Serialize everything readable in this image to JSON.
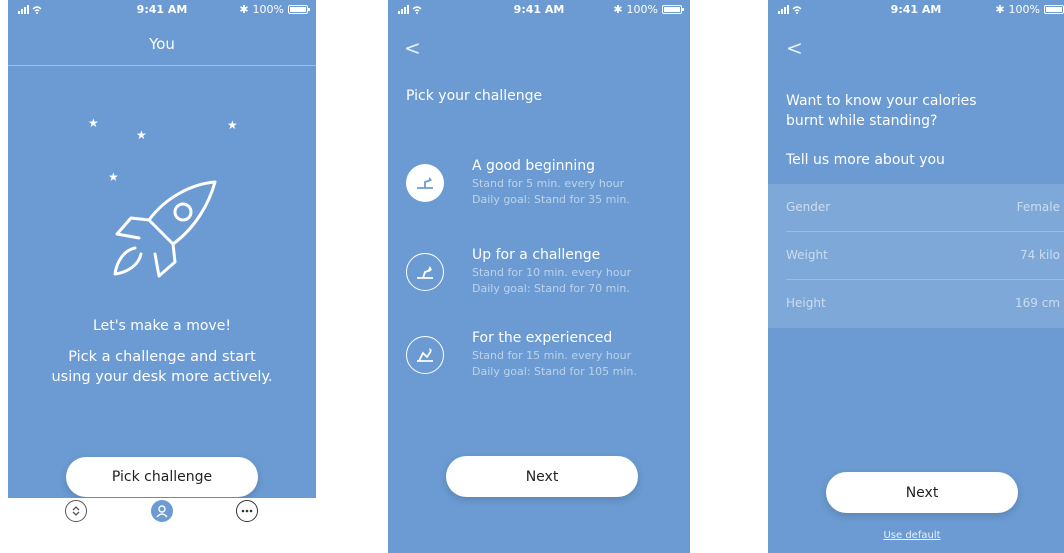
{
  "status_bar": {
    "time": "9:41 AM",
    "battery": "100%",
    "signal_icon": "signal-icon",
    "wifi_icon": "wifi-icon",
    "bluetooth_icon": "bluetooth-icon"
  },
  "colors": {
    "background": "#6b9bd2",
    "button": "#ffffff",
    "button_text": "#222222"
  },
  "screen1": {
    "header_title": "You",
    "headline": "Let's make a move!",
    "subtext_line1": "Pick a challenge and start",
    "subtext_line2": "using your desk more actively.",
    "button_label": "Pick challenge",
    "tabs": [
      {
        "icon": "up-down-arrows-icon"
      },
      {
        "icon": "user-icon",
        "active": true
      },
      {
        "icon": "more-icon"
      }
    ]
  },
  "screen2": {
    "back_label": "<",
    "title": "Pick your challenge",
    "options": [
      {
        "title": "A good beginning",
        "line1": "Stand for 5 min. every hour",
        "line2": "Daily goal: Stand for 35 min.",
        "selected": true
      },
      {
        "title": "Up for a challenge",
        "line1": "Stand for 10 min. every hour",
        "line2": "Daily goal: Stand for 70 min.",
        "selected": false
      },
      {
        "title": "For the experienced",
        "line1": "Stand for 15 min. every hour",
        "line2": "Daily goal: Stand for 105 min.",
        "selected": false
      }
    ],
    "button_label": "Next"
  },
  "screen3": {
    "back_label": "<",
    "question_line1": "Want to know your calories",
    "question_line2": "burnt while standing?",
    "tell_us": "Tell us more about you",
    "fields": [
      {
        "label": "Gender",
        "value": "Female"
      },
      {
        "label": "Weight",
        "value": "74 kilo"
      },
      {
        "label": "Height",
        "value": "169 cm"
      }
    ],
    "button_label": "Next",
    "use_default": "Use default"
  }
}
